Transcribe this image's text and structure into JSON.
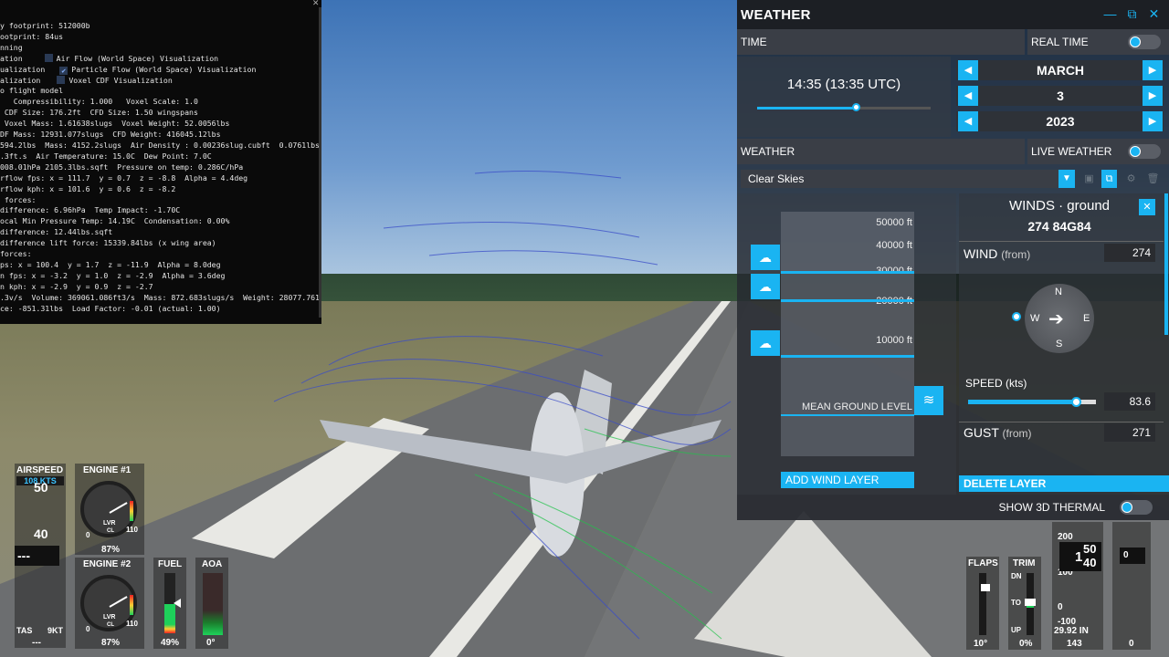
{
  "console": {
    "lines": [
      "y footprint: 512000b",
      "ootprint: 84us",
      "nning",
      "ation",
      "ualization",
      "alization",
      "o flight model",
      "   Compressibility: 1.000   Voxel Scale: 1.0",
      " CDF Size: 176.2ft  CFD Size: 1.50 wingspans",
      " Voxel Mass: 1.61638slugs  Voxel Weight: 52.0056lbs",
      "DF Mass: 12931.077slugs  CFD Weight: 416045.12lbs",
      "594.2lbs  Mass: 4152.2slugs  Air Density : 0.00236slug.cubft  0.0761lbs.",
      ".3ft.s  Air Temperature: 15.0C  Dew Point: 7.0C",
      "008.01hPa 2105.3lbs.sqft  Pressure on temp: 0.286C/hPa",
      "rflow fps: x = 111.7  y = 0.7  z = -8.8  Alpha = 4.4deg",
      "rflow kph: x = 101.6  y = 0.6  z = -8.2",
      " forces:",
      "difference: 6.96hPa  Temp Impact: -1.70C",
      "ocal Min Pressure Temp: 14.19C  Condensation: 0.00%",
      "difference: 12.44lbs.sqft",
      "difference lift force: 15339.84lbs (x wing area)",
      "forces:",
      "ps: x = 100.4  y = 1.7  z = -11.9  Alpha = 8.0deg",
      "n fps: x = -3.2  y = 1.0  z = -2.9  Alpha = 3.6deg",
      "n kph: x = -2.9  y = 0.9  z = -2.7",
      ".3v/s  Volume: 369061.086ft3/s  Mass: 872.683slugs/s  Weight: 28077.761l",
      "ce: -851.31lbs  Load Factor: -0.01 (actual: 1.00)"
    ],
    "opt_air_flow": "Air Flow (World Space) Visualization",
    "opt_particle_flow": "Particle Flow (World Space) Visualization",
    "opt_voxel": "Voxel CDF Visualization"
  },
  "weather": {
    "title": "WEATHER",
    "time_label": "TIME",
    "real_time_label": "REAL TIME",
    "time_value": "14:35 (13:35 UTC)",
    "time_slider_pct": 0.57,
    "month": "MARCH",
    "day": "3",
    "year": "2023",
    "weather_label": "WEATHER",
    "live_weather_label": "LIVE WEATHER",
    "preset": "Clear Skies",
    "altitudes": [
      "50000 ft",
      "40000 ft",
      "30000 ft",
      "20000 ft",
      "10000 ft"
    ],
    "mean_ground_level": "MEAN GROUND LEVEL",
    "add_wind_layer": "ADD WIND LAYER",
    "winds_title": "WINDS · ground",
    "winds_value": "274 84G84",
    "wind_from_label": "WIND",
    "wind_from_suffix": "(from)",
    "wind_from_value": "274",
    "compass": {
      "n": "N",
      "s": "S",
      "e": "E",
      "w": "W"
    },
    "speed_label": "SPEED (kts)",
    "speed_value": "83.6",
    "speed_slider_pct": 0.84,
    "gust_label": "GUST",
    "gust_suffix": "(from)",
    "gust_value": "271",
    "delete_layer": "DELETE LAYER",
    "show_3d_thermal": "SHOW 3D THERMAL"
  },
  "hud": {
    "airspeed_label": "AIRSPEED",
    "airspeed_value": "108 KTS",
    "tape_values": [
      "50",
      "40"
    ],
    "tape_pointer": "---",
    "tas_label": "TAS",
    "tas_value": "9KT",
    "tas_bottom": "---",
    "engine1_label": "ENGINE #1",
    "engine1_pct": "87%",
    "engine2_label": "ENGINE #2",
    "engine2_pct": "87%",
    "gauge_lvr": "LVR",
    "gauge_cl": "CL",
    "gauge_min": "0",
    "gauge_max": "110",
    "fuel_label": "FUEL",
    "fuel_value": "49%",
    "aoa_label": "AOA",
    "aoa_value": "0°",
    "flaps_label": "FLAPS",
    "flaps_value": "10°",
    "trim_label": "TRIM",
    "trim_dn": "DN",
    "trim_to": "TO",
    "trim_up": "UP",
    "trim_value": "0%",
    "alt_ticks": [
      "200",
      "100",
      "0",
      "-100"
    ],
    "alt_hundreds": "1",
    "alt_upper": "50",
    "alt_lower": "40",
    "baro": "29.92 IN",
    "alt_bottom": "143",
    "vs_value": "0",
    "vs_bottom": "0"
  },
  "colors": {
    "accent": "#1ab4f2",
    "green": "#1ed15a"
  }
}
